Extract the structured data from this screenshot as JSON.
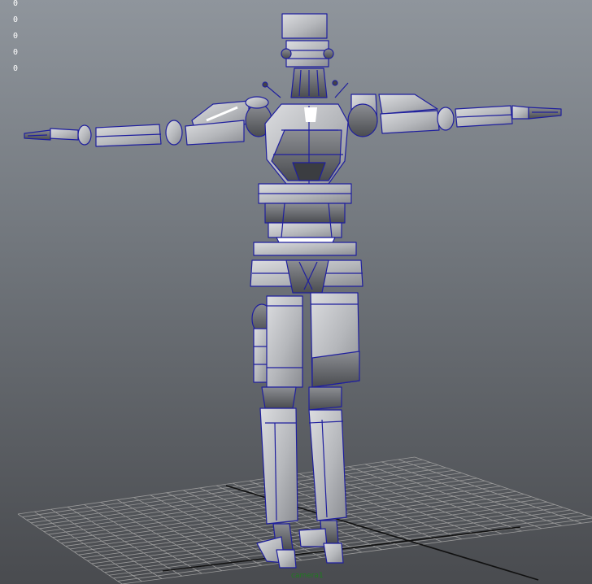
{
  "viewport": {
    "background_top": "#8f959c",
    "background_bottom": "#494b4f",
    "wireframe_color": "#1f1f9e",
    "model_shading": "#c8c9cb",
    "grid_color": "#9a9a9a",
    "origin_axis_color": "#111111"
  },
  "hud": {
    "values": [
      "0",
      "0",
      "0",
      "0",
      "0"
    ]
  },
  "camera_label": "camera1"
}
